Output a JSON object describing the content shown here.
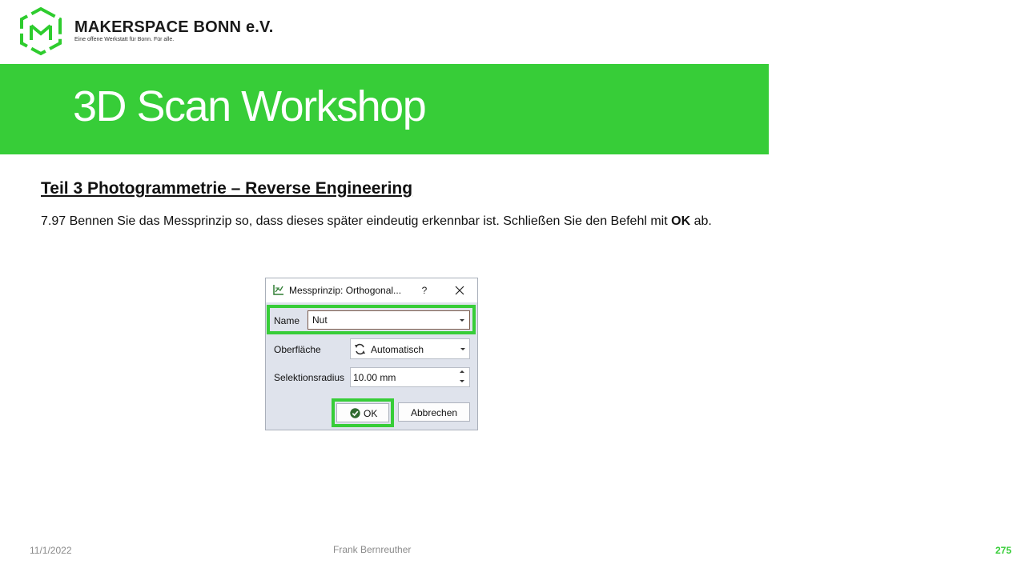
{
  "logo": {
    "name": "MAKERSPACE BONN e.V.",
    "tagline": "Eine offene Werkstatt für Bonn. Für alle.",
    "icon": "hexagon-m-logo-icon",
    "color": "#2ecc2e"
  },
  "banner": {
    "title": "3D Scan Workshop",
    "color": "#37cd38"
  },
  "section": {
    "heading": "Teil 3  Photogrammetrie  – Reverse Engineering",
    "instruction_prefix": "7.97 Bennen Sie das Messprinzip so, dass dieses später eindeutig erkennbar ist. Schließen Sie den Befehl mit ",
    "instruction_bold": "OK",
    "instruction_suffix": " ab."
  },
  "dialog": {
    "title": "Messprinzip: Orthogonal...",
    "help_label": "?",
    "title_icon": "measure-chart-icon",
    "fields": {
      "name_label": "Name",
      "name_value": "Nut",
      "surface_label": "Oberfläche",
      "surface_value": "Automatisch",
      "radius_label": "Selektionsradius",
      "radius_value": "10.00 mm"
    },
    "ok_label": "OK",
    "cancel_label": "Abbrechen",
    "highlight_color": "#37cd38"
  },
  "footer": {
    "date": "11/1/2022",
    "author": "Frank Bernreuther",
    "page": "275"
  }
}
